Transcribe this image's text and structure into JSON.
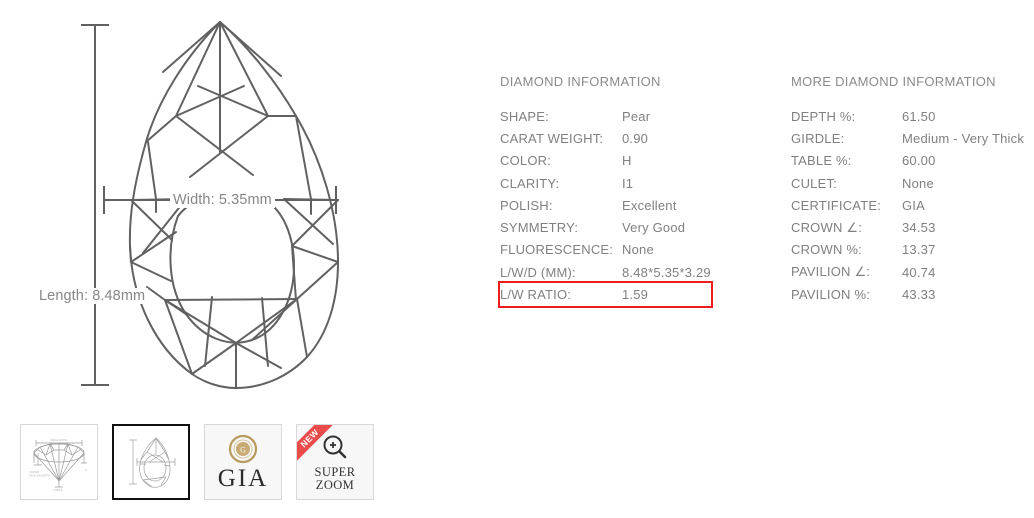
{
  "diagram": {
    "width_label": "Width: 5.35mm",
    "length_label": "Length: 8.48mm",
    "shape_name": "pear-diamond-diagram",
    "line_color": "#616161"
  },
  "thumbnails": [
    {
      "name": "diamond-profile-thumbnail",
      "label": "",
      "selected": false
    },
    {
      "name": "pear-outline-thumbnail",
      "label": "",
      "selected": true
    },
    {
      "name": "gia-certificate-thumbnail",
      "label": "GIA",
      "selected": false
    },
    {
      "name": "super-zoom-thumbnail",
      "label": "SUPER ZOOM",
      "badge": "NEW",
      "selected": false
    }
  ],
  "diamond_information": {
    "title": "DIAMOND INFORMATION",
    "rows": [
      {
        "label": "SHAPE:",
        "value": "Pear"
      },
      {
        "label": "CARAT WEIGHT:",
        "value": "0.90"
      },
      {
        "label": "COLOR:",
        "value": "H"
      },
      {
        "label": "CLARITY:",
        "value": "I1"
      },
      {
        "label": "POLISH:",
        "value": "Excellent"
      },
      {
        "label": "SYMMETRY:",
        "value": "Very Good"
      },
      {
        "label": "FLUORESCENCE:",
        "value": "None"
      },
      {
        "label": "L/W/D (MM):",
        "value": "8.48*5.35*3.29"
      },
      {
        "label": "L/W RATIO:",
        "value": "1.59",
        "highlight": true
      }
    ]
  },
  "more_diamond_information": {
    "title": "MORE DIAMOND INFORMATION",
    "rows": [
      {
        "label": "DEPTH %:",
        "value": "61.50"
      },
      {
        "label": "GIRDLE:",
        "value": "Medium - Very Thick"
      },
      {
        "label": "TABLE %:",
        "value": "60.00"
      },
      {
        "label": "CULET:",
        "value": "None"
      },
      {
        "label": "CERTIFICATE:",
        "value": "GIA"
      },
      {
        "label": "CROWN ∠:",
        "value": "34.53"
      },
      {
        "label": "CROWN %:",
        "value": "13.37"
      },
      {
        "label": "PAVILION ∠:",
        "value": "40.74"
      },
      {
        "label": "PAVILION %:",
        "value": "43.33"
      }
    ]
  },
  "colors": {
    "highlight_border": "#ee1c1c",
    "text": "#808080",
    "diagram_line": "#616161",
    "ribbon": "#ea4b4b",
    "gia_gold": "#b89a5e"
  }
}
